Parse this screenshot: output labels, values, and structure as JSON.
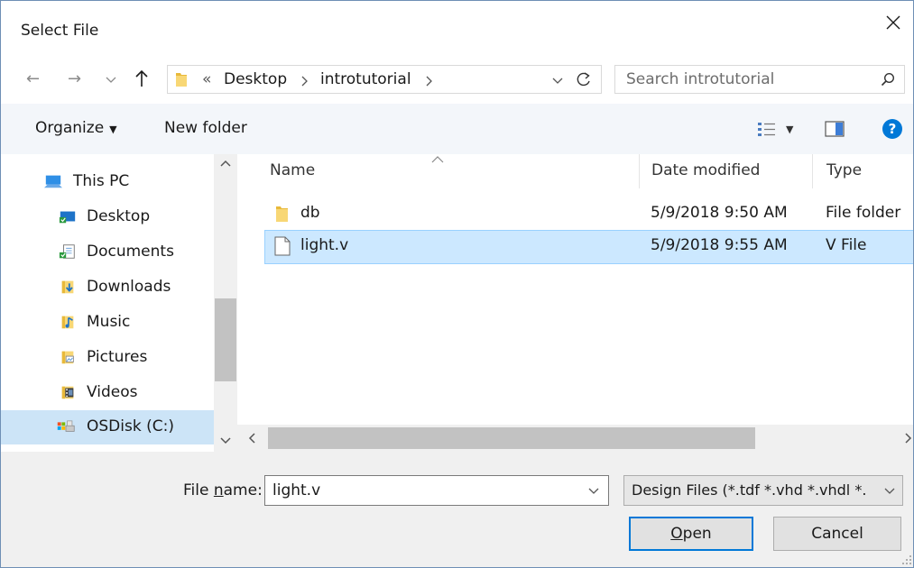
{
  "window": {
    "title": "Select File"
  },
  "nav": {
    "breadcrumb_overflow": "«",
    "path": [
      "Desktop",
      "introtutorial"
    ],
    "search_placeholder": "Search introtutorial"
  },
  "toolbar": {
    "organize": "Organize",
    "new_folder": "New folder"
  },
  "sidebar": {
    "items": [
      {
        "label": "This PC",
        "icon": "pc-icon"
      },
      {
        "label": "Desktop",
        "icon": "desktop-icon"
      },
      {
        "label": "Documents",
        "icon": "documents-icon"
      },
      {
        "label": "Downloads",
        "icon": "downloads-icon"
      },
      {
        "label": "Music",
        "icon": "music-icon"
      },
      {
        "label": "Pictures",
        "icon": "pictures-icon"
      },
      {
        "label": "Videos",
        "icon": "videos-icon"
      },
      {
        "label": "OSDisk (C:)",
        "icon": "drive-icon"
      }
    ]
  },
  "files": {
    "columns": [
      "Name",
      "Date modified",
      "Type"
    ],
    "rows": [
      {
        "name": "db",
        "date": "5/9/2018 9:50 AM",
        "type": "File folder",
        "icon": "folder-icon"
      },
      {
        "name": "light.v",
        "date": "5/9/2018 9:55 AM",
        "type": "V File",
        "icon": "file-icon"
      }
    ]
  },
  "footer": {
    "file_name_label_pre": "File ",
    "file_name_label_underlined": "n",
    "file_name_label_post": "ame:",
    "file_name_value": "light.v",
    "filter_value": "Design Files (*.tdf *.vhd *.vhdl *.",
    "open_underlined": "O",
    "open_rest": "pen",
    "cancel": "Cancel"
  },
  "colors": {
    "selection": "#cce8ff",
    "accent": "#0078d7",
    "help": "#0078d7"
  }
}
